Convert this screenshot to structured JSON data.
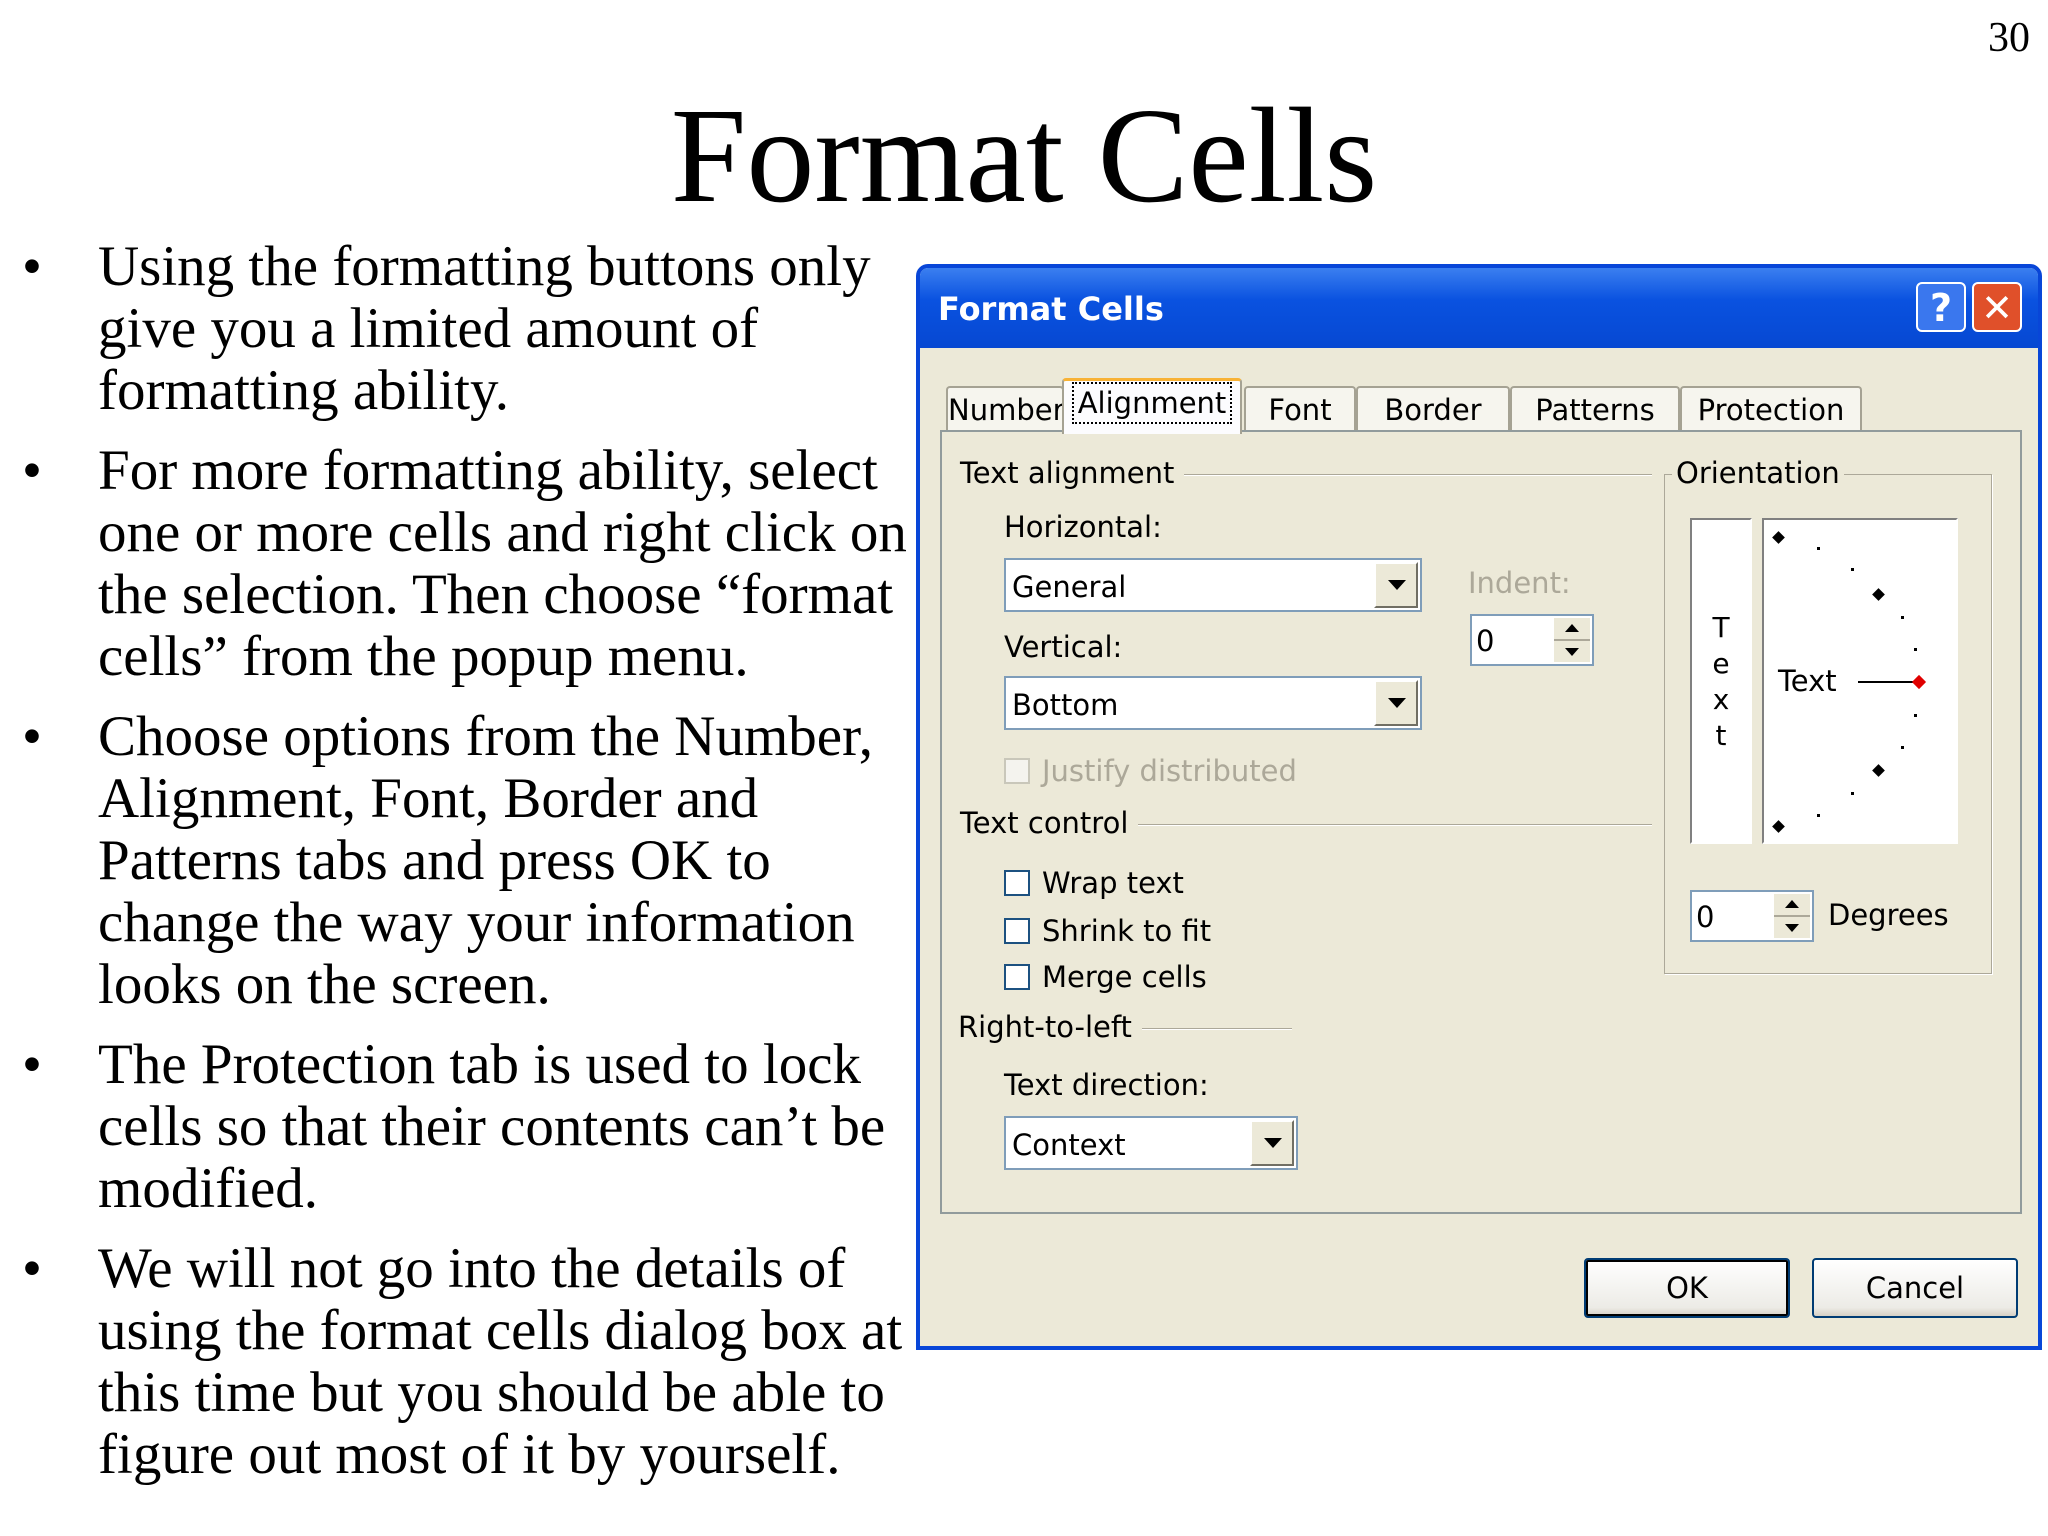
{
  "slide": {
    "number": "30",
    "title": "Format Cells",
    "bullet_char": "•",
    "bullets": [
      "Using the formatting buttons only give you a limited amount of formatting ability.",
      "For more formatting ability, select one or more cells and right click on the selection. Then choose “format cells” from the popup menu.",
      "Choose options from the Number, Alignment, Font, Border and Patterns tabs and press OK to change the way your information looks on the screen.",
      "The Protection tab is used to lock cells so that their contents can’t be modified.",
      "We will not go into the details of using the format cells dialog box at this time but you should be able to figure out most of it by yourself."
    ]
  },
  "dialog": {
    "title": "Format Cells",
    "help_glyph": "?",
    "close_glyph": "✕",
    "tabs": [
      "Number",
      "Alignment",
      "Font",
      "Border",
      "Patterns",
      "Protection"
    ],
    "active_tab": "Alignment",
    "text_alignment": {
      "group_label": "Text alignment",
      "horizontal_label": "Horizontal:",
      "horizontal_value": "General",
      "vertical_label": "Vertical:",
      "vertical_value": "Bottom",
      "indent_label": "Indent:",
      "indent_value": "0",
      "justify_distributed_label": "Justify distributed",
      "justify_distributed_checked": false
    },
    "text_control": {
      "group_label": "Text control",
      "options": [
        {
          "label": "Wrap text",
          "checked": false
        },
        {
          "label": "Shrink to fit",
          "checked": false
        },
        {
          "label": "Merge cells",
          "checked": false
        }
      ]
    },
    "right_to_left": {
      "group_label": "Right-to-left",
      "text_direction_label": "Text direction:",
      "text_direction_value": "Context"
    },
    "orientation": {
      "group_label": "Orientation",
      "vertical_text": [
        "T",
        "e",
        "x",
        "t"
      ],
      "dial_label": "Text",
      "degrees_value": "0",
      "degrees_label": "Degrees"
    },
    "ok_label": "OK",
    "cancel_label": "Cancel"
  },
  "colors": {
    "title_bar": "#0a52e0",
    "dialog_face": "#ece9d8",
    "close_button": "#e0502a",
    "dial_pointer": "#e00000"
  }
}
